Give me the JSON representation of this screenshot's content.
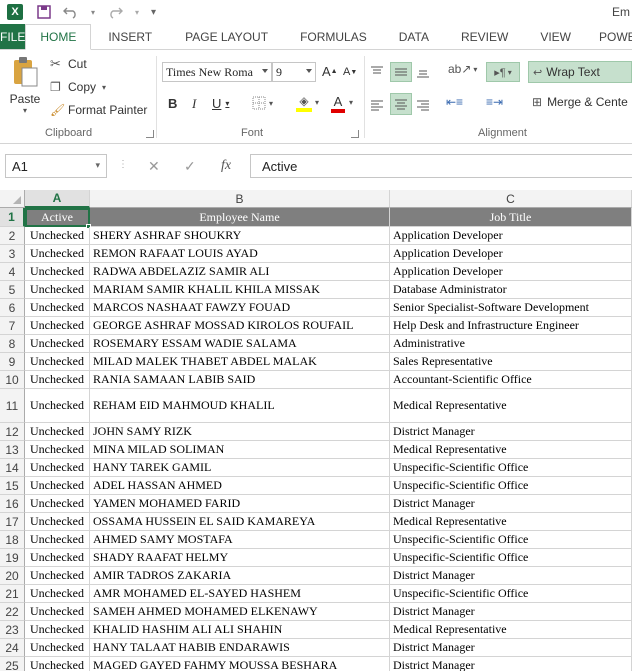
{
  "titlebar": {
    "app_icon": "X",
    "window_title": "Em",
    "undo_icon": "undo-icon",
    "redo_icon": "redo-icon",
    "save_icon": "save-icon"
  },
  "tabs": [
    {
      "label": "FILE"
    },
    {
      "label": "HOME"
    },
    {
      "label": "INSERT"
    },
    {
      "label": "PAGE LAYOUT"
    },
    {
      "label": "FORMULAS"
    },
    {
      "label": "DATA"
    },
    {
      "label": "REVIEW"
    },
    {
      "label": "VIEW"
    },
    {
      "label": "POWER Q"
    }
  ],
  "ribbon": {
    "clipboard": {
      "paste": "Paste",
      "cut": "Cut",
      "copy": "Copy",
      "format_painter": "Format Painter",
      "group": "Clipboard"
    },
    "font": {
      "name": "Times New Roma",
      "size": "9",
      "bold": "B",
      "italic": "I",
      "underline": "U",
      "grow": "A",
      "shrink": "A",
      "font_color": "A",
      "group": "Font"
    },
    "alignment": {
      "wrap_text": "Wrap Text",
      "merge_center": "Merge & Cente",
      "group": "Alignment"
    }
  },
  "formula_bar": {
    "name_box": "A1",
    "fx": "fx",
    "value": "Active"
  },
  "columns": [
    "A",
    "B",
    "C"
  ],
  "header": {
    "num": "1",
    "a": "Active",
    "b": "Employee Name",
    "c": "Job Title"
  },
  "rows": [
    {
      "num": "2",
      "a": "Unchecked",
      "b": "SHERY ASHRAF SHOUKRY",
      "c": "Application Developer"
    },
    {
      "num": "3",
      "a": "Unchecked",
      "b": "REMON RAFAAT LOUIS AYAD",
      "c": "Application Developer"
    },
    {
      "num": "4",
      "a": "Unchecked",
      "b": "RADWA ABDELAZIZ SAMIR ALI",
      "c": "Application Developer"
    },
    {
      "num": "5",
      "a": "Unchecked",
      "b": "MARIAM SAMIR KHALIL KHILA MISSAK",
      "c": "Database Administrator"
    },
    {
      "num": "6",
      "a": "Unchecked",
      "b": "MARCOS NASHAAT FAWZY FOUAD",
      "c": "Senior Specialist-Software Development"
    },
    {
      "num": "7",
      "a": "Unchecked",
      "b": "GEORGE ASHRAF MOSSAD KIROLOS ROUFAIL",
      "c": "Help Desk and Infrastructure Engineer"
    },
    {
      "num": "8",
      "a": "Unchecked",
      "b": "ROSEMARY ESSAM WADIE SALAMA",
      "c": "Administrative"
    },
    {
      "num": "9",
      "a": "Unchecked",
      "b": "MILAD MALEK THABET ABDEL MALAK",
      "c": "Sales Representative"
    },
    {
      "num": "10",
      "a": "Unchecked",
      "b": "RANIA SAMAAN LABIB SAID",
      "c": "Accountant-Scientific Office"
    },
    {
      "num": "11",
      "a": "Unchecked",
      "b": "REHAM EID MAHMOUD KHALIL",
      "c": "Medical Representative"
    },
    {
      "num": "12",
      "a": "Unchecked",
      "b": "JOHN SAMY RIZK",
      "c": "District Manager"
    },
    {
      "num": "13",
      "a": "Unchecked",
      "b": "MINA MILAD SOLIMAN",
      "c": "Medical Representative"
    },
    {
      "num": "14",
      "a": "Unchecked",
      "b": "HANY TAREK GAMIL",
      "c": "Unspecific-Scientific Office"
    },
    {
      "num": "15",
      "a": "Unchecked",
      "b": "ADEL HASSAN AHMED",
      "c": "Unspecific-Scientific Office"
    },
    {
      "num": "16",
      "a": "Unchecked",
      "b": "YAMEN MOHAMED FARID",
      "c": "District Manager"
    },
    {
      "num": "17",
      "a": "Unchecked",
      "b": "OSSAMA HUSSEIN EL SAID KAMAREYA",
      "c": "Medical Representative"
    },
    {
      "num": "18",
      "a": "Unchecked",
      "b": "AHMED SAMY MOSTAFA",
      "c": "Unspecific-Scientific Office"
    },
    {
      "num": "19",
      "a": "Unchecked",
      "b": "SHADY RAAFAT HELMY",
      "c": "Unspecific-Scientific Office"
    },
    {
      "num": "20",
      "a": "Unchecked",
      "b": "AMIR TADROS ZAKARIA",
      "c": "District Manager"
    },
    {
      "num": "21",
      "a": "Unchecked",
      "b": "AMR MOHAMED EL-SAYED HASHEM",
      "c": "Unspecific-Scientific Office"
    },
    {
      "num": "22",
      "a": "Unchecked",
      "b": "SAMEH AHMED MOHAMED ELKENAWY",
      "c": "District Manager"
    },
    {
      "num": "23",
      "a": "Unchecked",
      "b": "KHALID HASHIM ALI ALI SHAHIN",
      "c": "Medical Representative"
    },
    {
      "num": "24",
      "a": "Unchecked",
      "b": "HANY TALAAT HABIB ENDARAWIS",
      "c": "District Manager"
    },
    {
      "num": "25",
      "a": "Unchecked",
      "b": "MAGED GAYED FAHMY MOUSSA BESHARA",
      "c": "District Manager"
    }
  ],
  "colors": {
    "accent": "#217346",
    "header_fill": "#7f7f7f"
  }
}
